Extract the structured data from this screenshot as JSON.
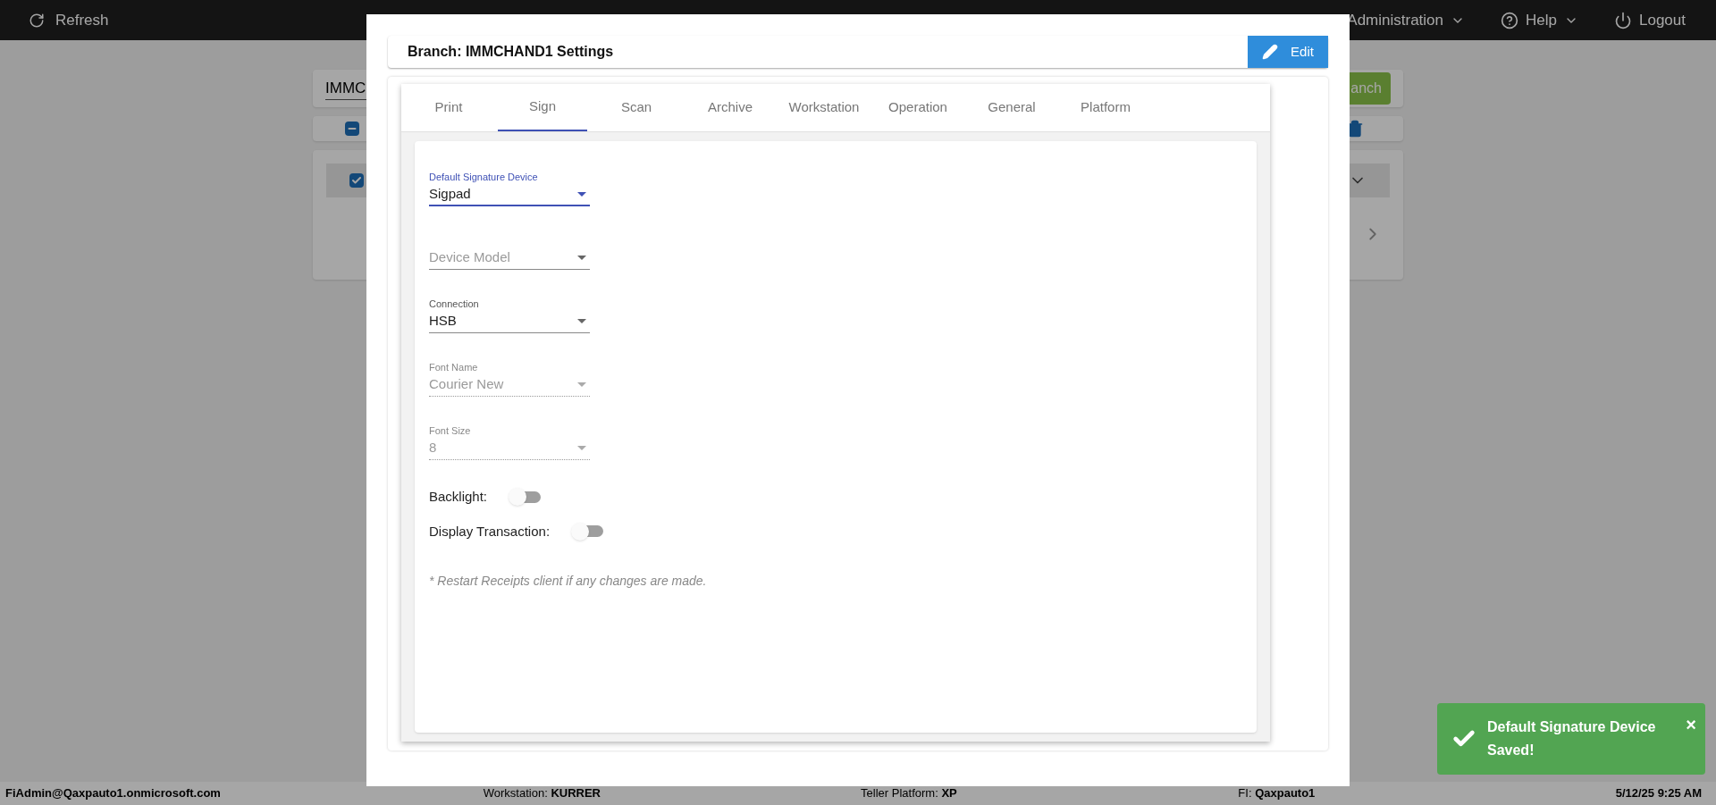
{
  "top_bar": {
    "refresh": "Refresh",
    "menus": [
      {
        "label": "Administration",
        "dropdown": true
      },
      {
        "label": "Help",
        "dropdown": true
      },
      {
        "label": "Logout",
        "dropdown": false
      }
    ]
  },
  "background": {
    "search_value": "IMMC",
    "search_button": "anch",
    "select_all": {
      "indeterminate": true
    },
    "row": {
      "checked": true
    }
  },
  "dialog": {
    "title": "Branch: IMMCHAND1 Settings",
    "edit_button": "Edit",
    "tabs": [
      {
        "label": "Print",
        "selected": false
      },
      {
        "label": "Sign",
        "selected": true
      },
      {
        "label": "Scan",
        "selected": false
      },
      {
        "label": "Archive",
        "selected": false
      },
      {
        "label": "Workstation",
        "selected": false
      },
      {
        "label": "Operation",
        "selected": false
      },
      {
        "label": "General",
        "selected": false
      },
      {
        "label": "Platform",
        "selected": false
      }
    ],
    "fields": [
      {
        "kind": "select",
        "label": "Default Signature Device",
        "value": "Sigpad",
        "focused": true,
        "disabled": false
      },
      {
        "kind": "select",
        "placeholder": "Device Model",
        "focused": false,
        "disabled": false
      },
      {
        "kind": "select",
        "label": "Connection",
        "value": "HSB",
        "focused": false,
        "disabled": false
      },
      {
        "kind": "select",
        "label": "Font Name",
        "value": "Courier New",
        "focused": false,
        "disabled": true
      },
      {
        "kind": "select",
        "label": "Font Size",
        "value": "8",
        "focused": false,
        "disabled": true
      },
      {
        "kind": "switch",
        "label": "Backlight:",
        "on": false
      },
      {
        "kind": "switch",
        "label": "Display Transaction:",
        "on": false
      }
    ],
    "note": "* Restart Receipts client if any changes are made."
  },
  "toast": {
    "message": "Default Signature Device Saved!",
    "close": "×"
  },
  "status_bar": {
    "user": "FiAdmin@Qaxpauto1.onmicrosoft.com",
    "items": [
      {
        "label": "Workstation: ",
        "value": "KURRER"
      },
      {
        "label": "Teller Platform: ",
        "value": "XP"
      },
      {
        "label": "FI: ",
        "value": "Qaxpauto1"
      }
    ],
    "datetime": "5/12/25 9:25 AM"
  }
}
